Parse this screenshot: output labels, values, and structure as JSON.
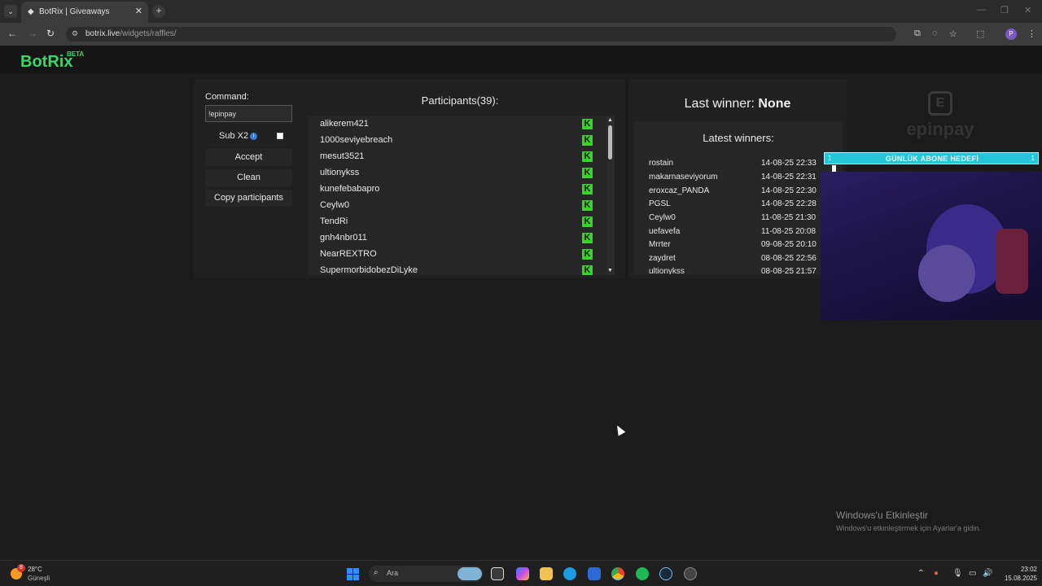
{
  "browser": {
    "tab_title": "BotRix | Giveaways",
    "tab_close": "✕",
    "tab_new": "+",
    "url_domain": "botrix.live",
    "url_path": "/widgets/raffles/"
  },
  "site": {
    "logo": "BotRix",
    "beta": "BETA"
  },
  "raffle": {
    "command_label": "Command:",
    "command_value": "!epinpay",
    "sub_label": "Sub X2",
    "sub_checked": false,
    "accept": "Accept",
    "clean": "Clean",
    "copy": "Copy participants",
    "participants_title": "Participants(39):",
    "participants": [
      "alikerem421",
      "1000seviyebreach",
      "mesut3521",
      "ultionykss",
      "kunefebabapro",
      "Ceylw0",
      "TendRi",
      "gnh4nbr011",
      "NearREXTRO",
      "SupermorbidobezDiLyke"
    ],
    "platform_icon": "kick-icon"
  },
  "winners": {
    "last_label": "Last winner:",
    "last_value": "None",
    "latest_title": "Latest winners:",
    "list": [
      {
        "name": "rostain",
        "date": "14-08-25 22:33"
      },
      {
        "name": "makarnaseviyorum",
        "date": "14-08-25 22:31"
      },
      {
        "name": "eroxcaz_PANDA",
        "date": "14-08-25 22:30"
      },
      {
        "name": "PGSL",
        "date": "14-08-25 22:28"
      },
      {
        "name": "Ceylw0",
        "date": "11-08-25 21:30"
      },
      {
        "name": "uefavefa",
        "date": "11-08-25 20:08"
      },
      {
        "name": "Mrrter",
        "date": "09-08-25 20:10"
      },
      {
        "name": "zaydret",
        "date": "08-08-25 22:56"
      },
      {
        "name": "ultionykss",
        "date": "08-08-25 21:57"
      }
    ]
  },
  "overlay": {
    "brand": "epinpay",
    "goal_text": "GÜNLÜK ABONE HEDEFİ",
    "goal_left": "1",
    "goal_right": "1"
  },
  "activation": {
    "title": "Windows'u Etkinleştir",
    "subtitle": "Windows'u etkinleştirmek için Ayarlar'a gidin."
  },
  "taskbar": {
    "weather_badge": "8",
    "weather_temp": "28°C",
    "weather_cond": "Güneşli",
    "search_placeholder": "Ara",
    "time": "23:02",
    "date": "15.08.2025"
  },
  "colors": {
    "brand_green": "#3fd46a",
    "kick_green": "#3ad12c",
    "goal_cyan": "#26c6da"
  }
}
